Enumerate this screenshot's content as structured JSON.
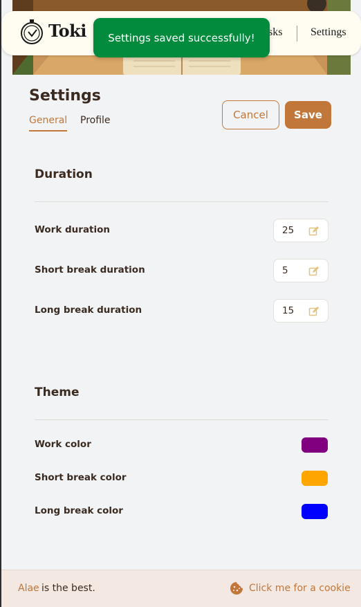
{
  "app": {
    "name": "Toki"
  },
  "nav": {
    "tasks_label": "sks",
    "settings_label": "Settings"
  },
  "toast": {
    "message": "Settings saved successfully!"
  },
  "header": {
    "title": "Settings",
    "tabs": [
      {
        "label": "General"
      },
      {
        "label": "Profile"
      }
    ],
    "cancel_label": "Cancel",
    "save_label": "Save"
  },
  "duration": {
    "title": "Duration",
    "rows": [
      {
        "label": "Work duration",
        "value": "25"
      },
      {
        "label": "Short break duration",
        "value": "5"
      },
      {
        "label": "Long break duration",
        "value": "15"
      }
    ]
  },
  "theme": {
    "title": "Theme",
    "rows": [
      {
        "label": "Work color",
        "color": "#800080"
      },
      {
        "label": "Short break color",
        "color": "#ffa500"
      },
      {
        "label": "Long break color",
        "color": "#0000ff"
      }
    ]
  },
  "footer": {
    "name": "Alae",
    "text": "is the best.",
    "cookie_label": "Click me for a cookie"
  },
  "colors": {
    "accent": "#c2773a",
    "toast_bg": "#028a3d",
    "text": "#3b2a1f"
  },
  "icons": [
    "stopwatch-logo-icon",
    "edit-icon",
    "cookie-icon"
  ]
}
